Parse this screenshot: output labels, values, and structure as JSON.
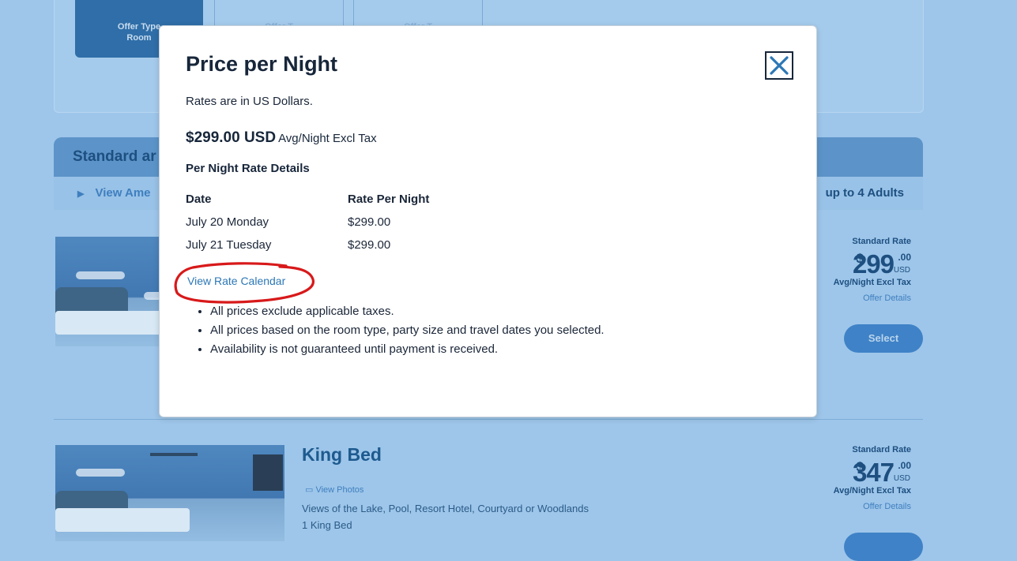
{
  "background": {
    "offer_types": [
      {
        "label_line1": "Offer Type",
        "label_line2": "Room",
        "selected": true
      },
      {
        "label_line1": "Offer T",
        "label_line2": "",
        "selected": false
      },
      {
        "label_line1": "Offer T",
        "label_line2": "",
        "selected": false
      }
    ],
    "section_title": "Standard ar",
    "view_amenities_label": "View Ame",
    "occupancy_label": "up to 4 Adults",
    "rooms": [
      {
        "rate_label": "Standard Rate",
        "currency_symbol": "$",
        "price_whole": "299",
        "price_cents": ".00",
        "currency": "USD",
        "per_night_label": "Avg/Night Excl Tax",
        "offer_details_link": "Offer Details",
        "select_label": "Select"
      },
      {
        "name": "King Bed",
        "view_photos_label": "View Photos",
        "views": "Views of the Lake, Pool, Resort Hotel, Courtyard or Woodlands",
        "beds": "1 King Bed",
        "rate_label": "Standard Rate",
        "currency_symbol": "$",
        "price_whole": "347",
        "price_cents": ".00",
        "currency": "USD",
        "per_night_label": "Avg/Night Excl Tax",
        "offer_details_link": "Offer Details"
      }
    ]
  },
  "modal": {
    "title": "Price per Night",
    "rates_note": "Rates are in US Dollars.",
    "avg_amount": "$299.00 USD",
    "avg_suffix": "Avg/Night Excl Tax",
    "details_title": "Per Night Rate Details",
    "table": {
      "headers": [
        "Date",
        "Rate Per Night"
      ],
      "rows": [
        [
          "July 20 Monday",
          "$299.00"
        ],
        [
          "July 21 Tuesday",
          "$299.00"
        ]
      ]
    },
    "calendar_link": "View Rate Calendar",
    "notes": [
      "All prices exclude applicable taxes.",
      "All prices based on the room type, party size and travel dates you selected.",
      "Availability is not guaranteed until payment is received."
    ]
  },
  "colors": {
    "overlay_blue": "#9ec6ea",
    "link_blue": "#2c77b6",
    "annotation_red": "#d8191a",
    "title_navy": "#17263a"
  }
}
